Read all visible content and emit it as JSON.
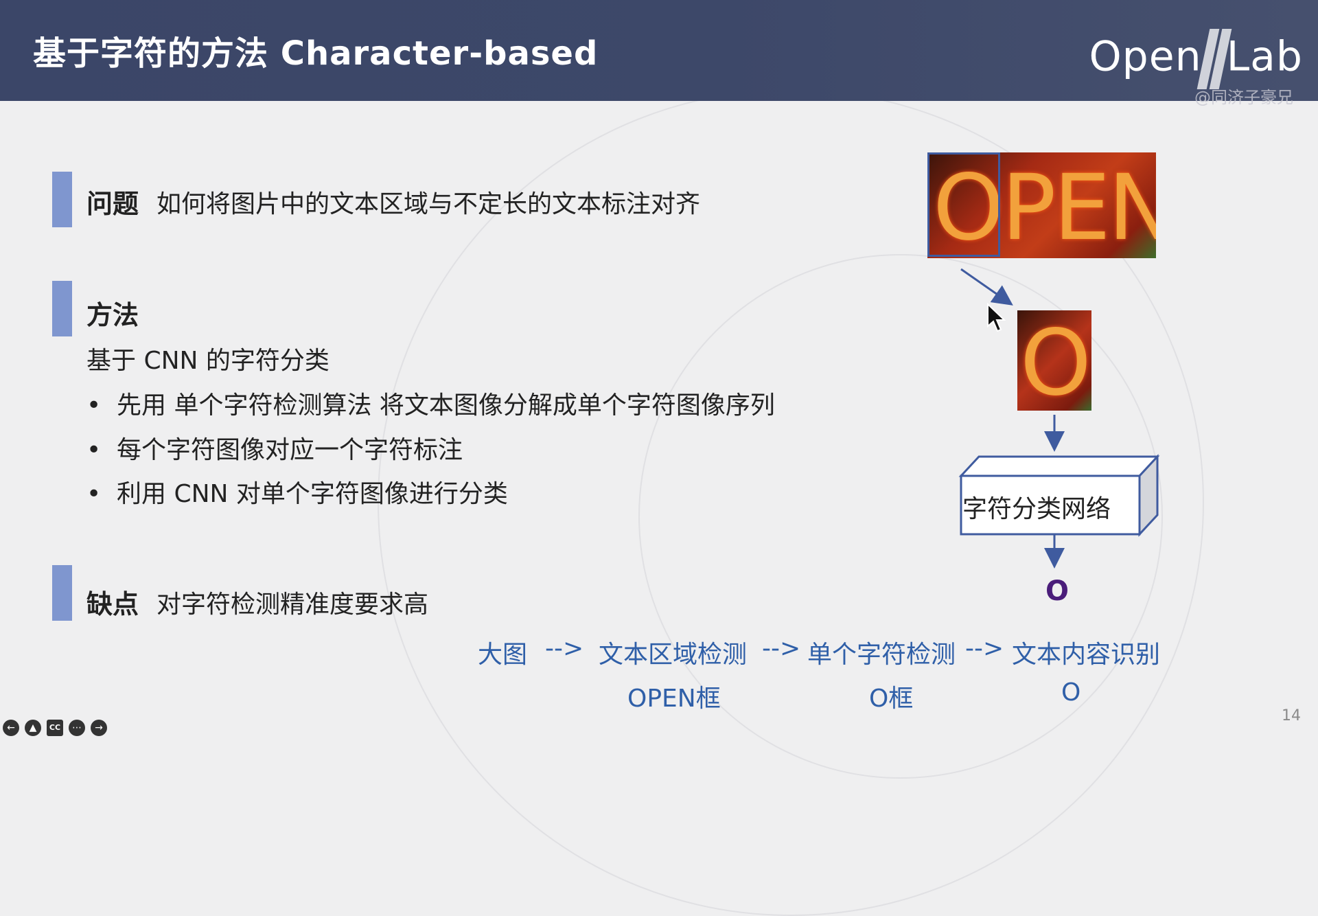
{
  "header": {
    "title": "基于字符的方法 Character-based",
    "logo_text_left": "Open",
    "logo_text_right": "Lab",
    "watermark": "@同济子豪兄"
  },
  "sections": {
    "problem": {
      "label": "问题",
      "text": "如何将图片中的文本区域与不定长的文本标注对齐"
    },
    "method": {
      "label": "方法",
      "subtitle": "基于 CNN 的字符分类",
      "bullets": [
        "先用 单个字符检测算法 将文本图像分解成单个字符图像序列",
        "每个字符图像对应一个字符标注",
        "利用 CNN 对单个字符图像进行分类"
      ]
    },
    "drawback": {
      "label": "缺点",
      "text": "对字符检测精准度要求高"
    }
  },
  "diagram": {
    "image_big_text": "OPEN",
    "image_small_text": "O",
    "network_label": "字符分类网络",
    "output": "O"
  },
  "pipeline": {
    "row1": {
      "step1": "大图",
      "arrow1": "-->",
      "step2": "文本区域检测",
      "arrow2": "-->",
      "step3": "单个字符检测",
      "arrow3": "-->",
      "step4": "文本内容识别"
    },
    "row2": {
      "item1": "OPEN框",
      "item2": "O框",
      "item3": "O"
    }
  },
  "page_number": "14",
  "player_controls": [
    "prev-icon",
    "user-icon",
    "cc-icon",
    "more-icon",
    "next-icon"
  ],
  "colors": {
    "header_bg": "#3d4869",
    "section_bar": "#7f96cf",
    "pipeline_text": "#2f5fa8",
    "diagram_stroke": "#3f5b9f",
    "output_text": "#4a1d7a"
  }
}
